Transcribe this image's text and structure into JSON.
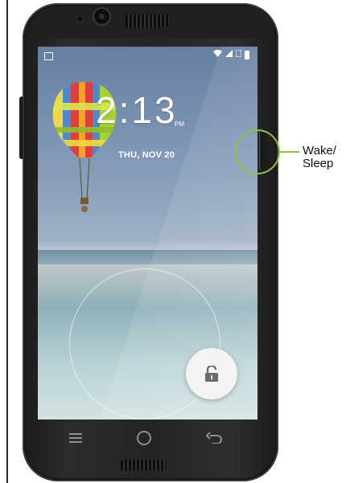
{
  "lock_screen": {
    "time": "2:13",
    "ampm": "PM",
    "date": "THU, NOV 20"
  },
  "status_bar": {
    "left_icon": "image-icon",
    "right_icons": [
      "wifi-icon",
      "signal-icon",
      "sim-icon",
      "battery-icon"
    ]
  },
  "navigation": {
    "menu_icon": "menu-icon",
    "home_icon": "home-icon",
    "back_icon": "back-icon"
  },
  "unlock": {
    "icon": "unlock-icon"
  },
  "callout": {
    "label": "Wake/\nSleep",
    "color": "#8bc53f"
  },
  "colors": {
    "phone_body": "#242424",
    "unlock_button": "#f3f3f3"
  }
}
